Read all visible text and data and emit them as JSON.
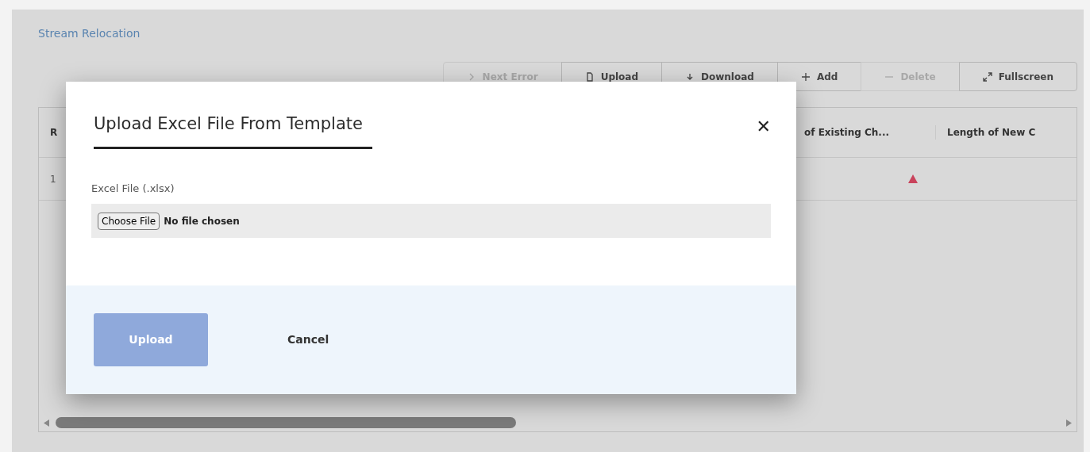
{
  "page": {
    "title": "Stream Relocation"
  },
  "toolbar": [
    {
      "label": "Next Error",
      "disabled": true
    },
    {
      "label": "Upload",
      "disabled": false
    },
    {
      "label": "Download",
      "disabled": false
    },
    {
      "label": "Add",
      "disabled": false
    },
    {
      "label": "Delete",
      "disabled": true
    },
    {
      "label": "Fullscreen",
      "disabled": false
    }
  ],
  "table": {
    "columns": [
      "R",
      "of Existing Ch...",
      "Length of New C"
    ],
    "rows": [
      {
        "column_1": "1",
        "warning": true
      }
    ]
  },
  "dialog": {
    "title": "Upload Excel File From Template",
    "close": "✕",
    "field_label": "Excel File (.xlsx)",
    "file_button": "Choose File",
    "file_status": "No file chosen",
    "upload_button": {
      "label": "Upload",
      "disabled": true
    },
    "cancel_button": "Cancel"
  }
}
